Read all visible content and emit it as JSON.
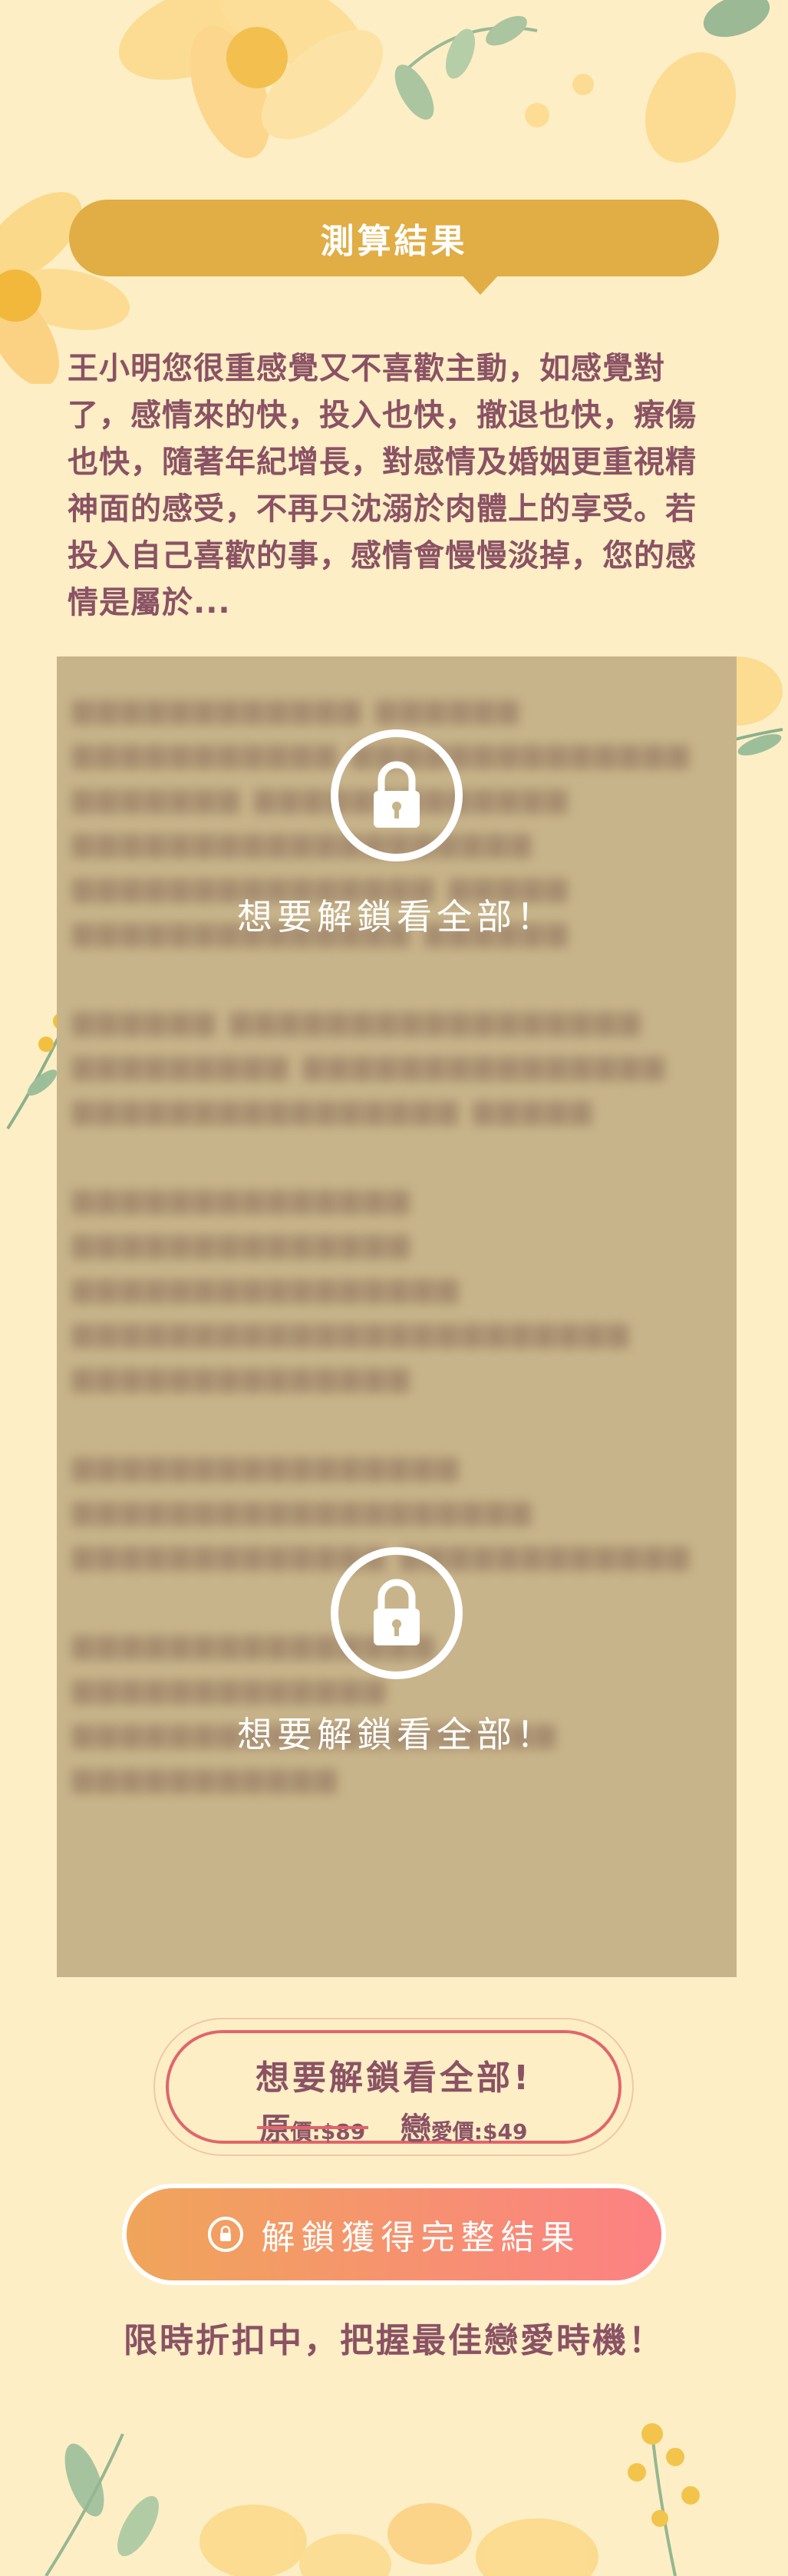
{
  "header": {
    "title": "測算結果"
  },
  "intro": {
    "text": "王小明您很重感覺又不喜歡主動，如感覺對了，感情來的快，投入也快，撤退也快，療傷也快，隨著年紀增長，對感情及婚姻更重視精神面的感受，不再只沈溺於肉體上的享受。若投入自己喜歡的事，感情會慢慢淡掉，您的感情是屬於..."
  },
  "locked_section": {
    "unlock_prompt_1": "想要解鎖看全部！",
    "unlock_prompt_2": "想要解鎖看全部！"
  },
  "pricing": {
    "title": "想要解鎖看全部!",
    "original_char": "原",
    "original_suffix": "價:$89",
    "love_char": "戀",
    "love_suffix": "愛價:$49"
  },
  "cta": {
    "label": "解鎖獲得完整結果",
    "icon": "lock-icon"
  },
  "promo": {
    "text": "限時折扣中，把握最佳戀愛時機！"
  },
  "colors": {
    "background": "#fdeec5",
    "header": "#e1ad45",
    "text": "#8a5264",
    "accent_red": "#e0666a",
    "cta_start": "#f0a55a",
    "cta_end": "#fc8183"
  }
}
